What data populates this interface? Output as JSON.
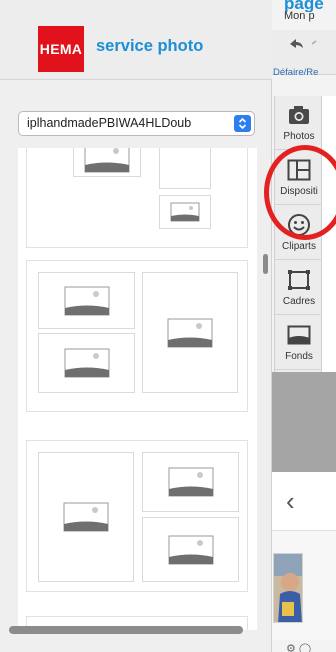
{
  "brand": {
    "logo_text": "HEMA",
    "title": "service photo",
    "brand_color": "#1e8fd6",
    "logo_color": "#e1121b"
  },
  "project": {
    "title": "page",
    "name": "Mon p"
  },
  "toolbar": {
    "undo_label": "Défaire/Re"
  },
  "selector": {
    "value": "iplhandmadePBIWA4HLDoub"
  },
  "tools": [
    {
      "label": "Photos",
      "icon": "camera-icon"
    },
    {
      "label": "Dispositi",
      "icon": "layout-icon"
    },
    {
      "label": "Cliparts",
      "icon": "smiley-icon"
    },
    {
      "label": "Cadres",
      "icon": "frame-icon"
    },
    {
      "label": "Fonds",
      "icon": "background-icon"
    }
  ],
  "footer": {
    "status": "...",
    "status_text": ""
  },
  "colors": {
    "accent": "#2d7ff0",
    "highlight": "#e42121"
  }
}
